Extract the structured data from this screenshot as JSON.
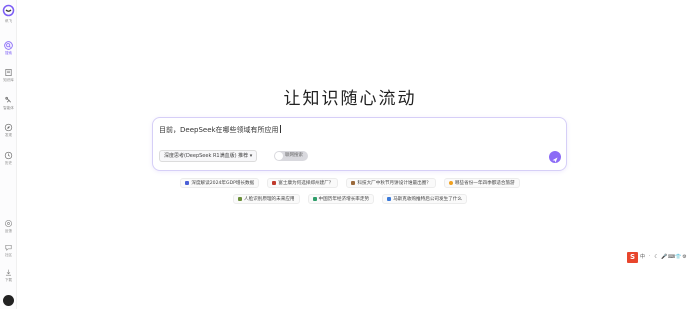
{
  "sidebar": {
    "logo_label": "讯飞",
    "items": [
      {
        "label": "搜索",
        "icon": "search-icon",
        "active": true
      },
      {
        "label": "知识库",
        "icon": "book-icon",
        "active": false
      },
      {
        "label": "智能体",
        "icon": "agent-icon",
        "active": false
      },
      {
        "label": "发现",
        "icon": "discover-icon",
        "active": false
      },
      {
        "label": "历史",
        "icon": "history-icon",
        "active": false
      }
    ],
    "bottom_items": [
      {
        "label": "反馈",
        "icon": "feedback-icon"
      },
      {
        "label": "社区",
        "icon": "community-icon"
      },
      {
        "label": "下载",
        "icon": "download-icon"
      }
    ]
  },
  "hero": {
    "title": "让知识随心流动"
  },
  "search": {
    "query": "目前，DeepSeek在哪些领域有所应用",
    "mode_label": "深度思考(DeepSeek R1满血版) 推荐 ▾",
    "toggle_label": "联网搜索",
    "accent": "#8c6cf6"
  },
  "suggestions": {
    "row1": [
      {
        "text": "深度解读2024年GDP增长数据",
        "color": "#4a5fd6"
      },
      {
        "text": "富士康为何选择郑州建厂？",
        "color": "#c0392b"
      },
      {
        "text": "科技大厂中秋节月饼设计谁最出圈？",
        "color": "#9b6a3c"
      },
      {
        "text": "哪些省份一年四季都适合旅游",
        "color": "#f0a020"
      }
    ],
    "row2": [
      {
        "text": "人脸识别原理的未来应用",
        "color": "#6b8f3a"
      },
      {
        "text": "中国历年经济增长率走势",
        "color": "#2e9e6a"
      },
      {
        "text": "马斯克收购推特后公司发生了什么",
        "color": "#3b7ad9"
      }
    ]
  },
  "tray": {
    "logo": "S",
    "icons": [
      "中",
      "ᐧ",
      "☾",
      "🎤",
      "⌨",
      "👕",
      "⚙"
    ]
  }
}
